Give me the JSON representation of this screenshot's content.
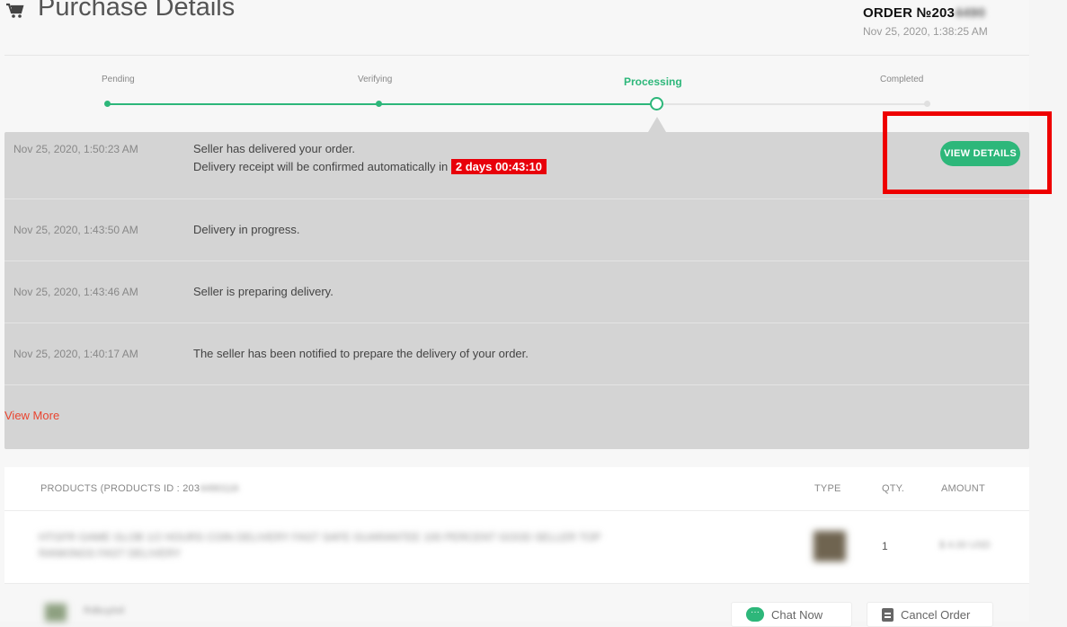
{
  "header": {
    "title": "Purchase Details",
    "order_prefix": "ORDER №203",
    "order_blurred": "4490",
    "order_date": "Nov 25, 2020, 1:38:25 AM"
  },
  "progress": {
    "steps": [
      {
        "label": "Pending",
        "state": "done"
      },
      {
        "label": "Verifying",
        "state": "done"
      },
      {
        "label": "Processing",
        "state": "current"
      },
      {
        "label": "Completed",
        "state": "pending"
      }
    ]
  },
  "timeline": {
    "events": [
      {
        "time": "Nov 25, 2020, 1:50:23 AM",
        "line1": "Seller has delivered your order.",
        "line2": "Delivery receipt will be confirmed automatically in",
        "countdown": "2 days 00:43:10",
        "button": "VIEW DETAILS"
      },
      {
        "time": "Nov 25, 2020, 1:43:50 AM",
        "message": "Delivery in progress."
      },
      {
        "time": "Nov 25, 2020, 1:43:46 AM",
        "message": "Seller is preparing delivery."
      },
      {
        "time": "Nov 25, 2020, 1:40:17 AM",
        "message": "The seller has been notified to prepare the delivery of your order."
      }
    ],
    "view_more": "View More"
  },
  "products": {
    "header_prefix": "PRODUCTS (PRODUCTS ID : 203",
    "header_blurred": "4490116",
    "col_type": "TYPE",
    "col_qty": "QTY.",
    "col_amount": "AMOUNT",
    "item": {
      "name_blurred": "HTGFR GAME GLOB 1/2 HOURS COIN DELIVERY FAST SAFE GUARANTEE 100 PERCENT GOOD SELLER TOP",
      "name_blurred_2": "RANKINGS FAST DELIVERY",
      "qty": "1",
      "amount_blurred": "$ 4.00 USD"
    },
    "seller_blurred": "Rdbuyloil",
    "chat_label": "Chat Now",
    "cancel_label": "Cancel Order"
  },
  "colors": {
    "accent_green": "#2db77a",
    "countdown_red": "#e8000a",
    "annotation_red": "#ee0000",
    "link_red": "#e9442f"
  }
}
